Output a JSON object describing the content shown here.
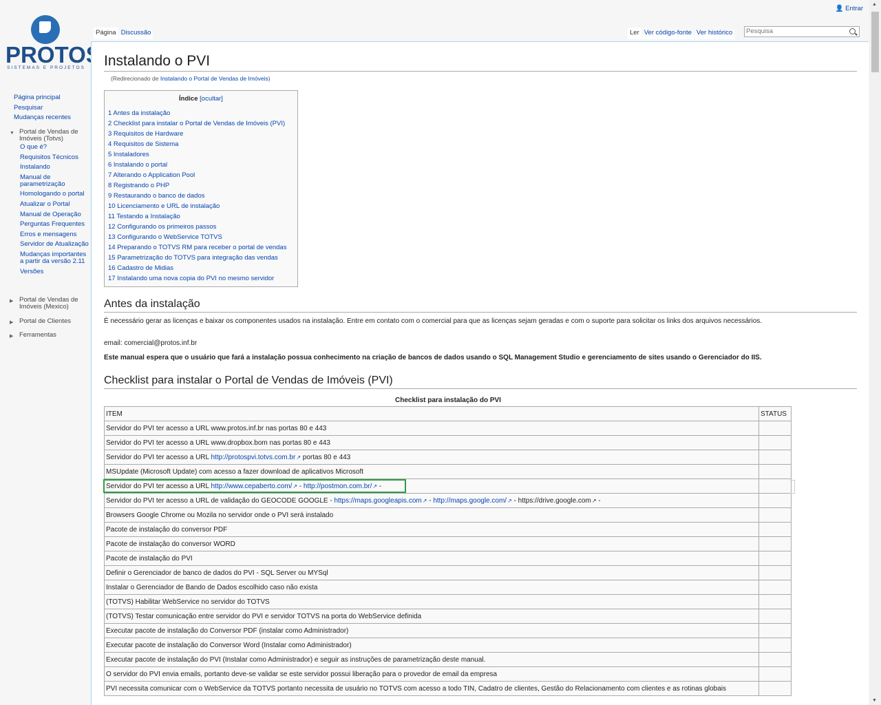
{
  "logo": {
    "name": "PROTOS",
    "tagline": "SISTEMAS E PROJETOS"
  },
  "header": {
    "login": "Entrar",
    "tabs_left": [
      "Página",
      "Discussão"
    ],
    "tabs_right": [
      "Ler",
      "Ver código-fonte",
      "Ver histórico"
    ],
    "search_placeholder": "Pesquisa"
  },
  "sidebar": {
    "main_links": [
      "Página principal",
      "Pesquisar",
      "Mudanças recentes"
    ],
    "portal_section": "Portal de Vendas de Imóveis (Totvs)",
    "portal_items": [
      "O que é?",
      "Requisitos Técnicos",
      "Instalando",
      "Manual de parametrização",
      "Homologando o portal",
      "Atualizar o Portal",
      "Manual de Operação",
      "Perguntas Frequentes",
      "Erros e mensagens",
      "Servidor de Atualização",
      "Mudanças importantes a partir da versão 2.11",
      "Versões"
    ],
    "mexico_section": "Portal de Vendas de Imóveis (Mexico)",
    "clientes_section": "Portal de Clientes",
    "ferramentas_section": "Ferramentas"
  },
  "page": {
    "title": "Instalando o PVI",
    "redirect_prefix": "(Redirecionado de ",
    "redirect_link": "Instalando o Portal de Vendas de Imóveis",
    "redirect_suffix": ")"
  },
  "toc": {
    "title": "Índice",
    "toggle": "[ocultar]",
    "items": [
      "1 Antes da instalação",
      "2 Checklist para instalar o Portal de Vendas de Imóveis (PVI)",
      "3 Requisitos de Hardware",
      "4 Requisitos de Sistema",
      "5 Instaladores",
      "6 Instalando o portal",
      "7 Alterando o Application Pool",
      "8 Registrando o PHP",
      "9 Restaurando o banco de dados",
      "10 Licenciamento e URL de instalação",
      "11 Testando a Instalação",
      "12 Configurando os primeiros passos",
      "13 Configurando o WebService TOTVS",
      "14 Preparando o TOTVS RM para receber o portal de vendas",
      "15 Parametrização do TOTVS para integração das vendas",
      "16 Cadastro de Midias",
      "17 Instalando uma nova copia do PVI no mesmo servidor"
    ]
  },
  "section1": {
    "heading": "Antes da instalação",
    "para1": "É necessário gerar as licenças e baixar os componentes usados na instalação. Entre em contato com o comercial para que as licenças sejam geradas e com o suporte para solicitar os links dos arquivos necessários.",
    "email": "email: comercial@protos.inf.br",
    "bold_note": "Este manual espera que o usuário que fará a instalação possua conhecimento na criação de bancos de dados usando o SQL Management Studio e gerenciamento de sites usando o Gerenciador do IIS."
  },
  "section2": {
    "heading": "Checklist para instalar o Portal de Vendas de Imóveis (PVI)",
    "table_caption": "Checklist para instalação do PVI",
    "col_item": "ITEM",
    "col_status": "STATUS",
    "rows": [
      "Servidor do PVI ter acesso a URL www.protos.inf.br nas portas 80 e 443",
      "Servidor do PVI ter acesso a URL www.dropbox.bom nas portas 80 e 443",
      "MSUpdate (Microsoft Update) com acesso a fazer download de aplicativos Microsoft",
      "Browsers Google Chrome ou Mozila no servidor onde o PVI será instalado",
      "Pacote de instalação do conversor PDF",
      "Pacote de instalação do conversor WORD",
      "Pacote de instalação do PVI",
      "Definir o Gerenciador de banco de dados do PVI - SQL Server ou MYSql",
      "Instalar o Gerenciador de Bando de Dados escolhido caso não exista",
      "(TOTVS) Habilitar WebService no servidor do TOTVS",
      "(TOTVS) Testar comunicação entre servidor do PVI e servidor TOTVS na porta do WebService definida",
      "Executar pacote de instalação do Conversor PDF (instalar como Administrador)",
      "Executar pacote de instalação do Conversor Word (Instalar como Administrador)",
      "Executar pacote de instalação do PVI (Instalar como Administrador) e seguir as instruções de parametrização deste manual.",
      "O servidor do PVI envia emails, portanto deve-se validar se este servidor possui liberação para o provedor de email da empresa",
      "PVI necessita comunicar com o WebService da TOTVS portanto necessita de usuário no TOTVS com acesso a todo TIN, Cadatro de clientes, Gestão do Relacionamento com clientes e as rotinas globais"
    ],
    "row3": {
      "prefix": "Servidor do PVI ter acesso a URL ",
      "link": "http://protospvi.totvs.com.br",
      "suffix": " portas 80 e 443"
    },
    "row5": {
      "prefix": "Servidor do PVI ter acesso a URL ",
      "link1": "http://www.cepaberto.com/",
      "sep": " - ",
      "link2": "http://postmon.com.br/",
      "suffix": " -"
    },
    "row6": {
      "prefix": "Servidor do PVI ter acesso a URL de validação do GEOCODE GOOGLE - ",
      "link1": "https://maps.googleapis.com",
      "link2": "http://maps.google.com/",
      "link3": "https://drive.google.com",
      "sep": " - ",
      "suffix": " -"
    }
  }
}
